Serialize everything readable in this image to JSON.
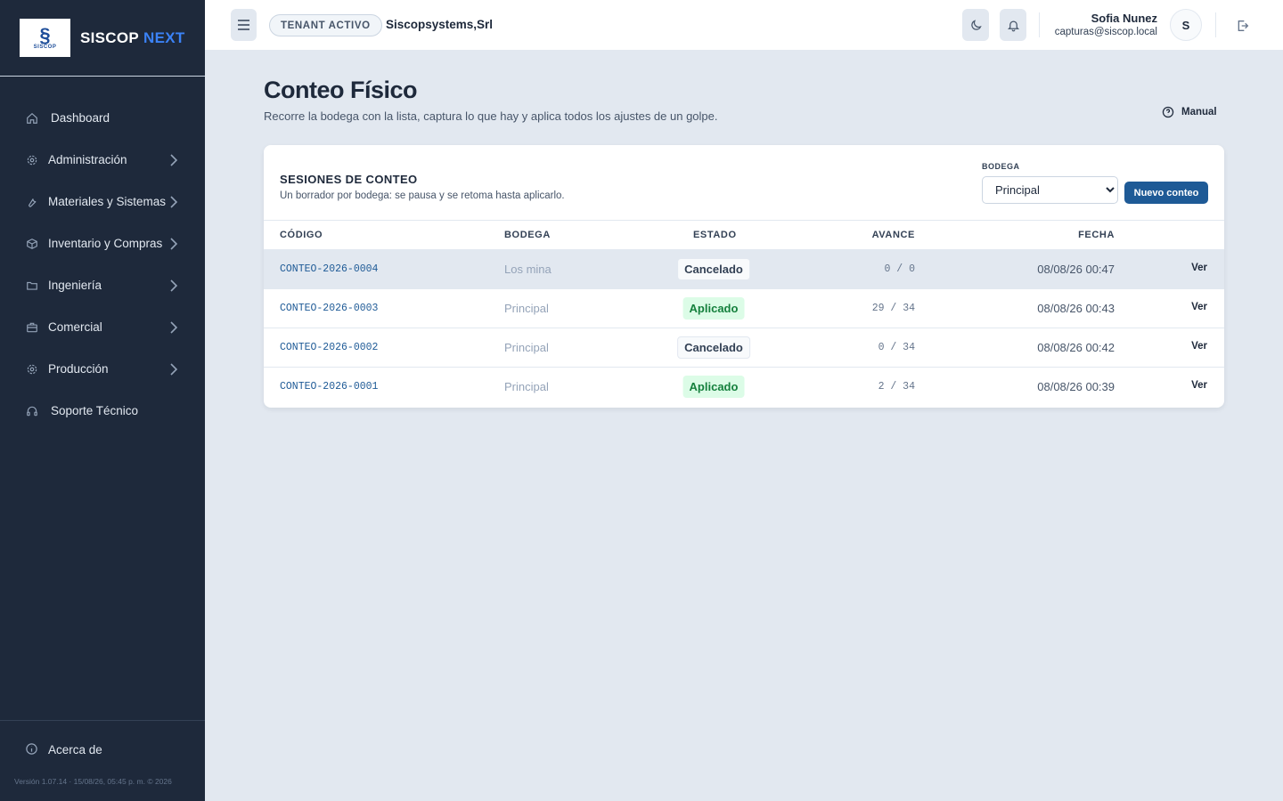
{
  "brand": {
    "logo_text": "SISCOP",
    "name": "SISCOP",
    "name_accent": "NEXT"
  },
  "sidebar": {
    "items": [
      {
        "label": "Dashboard",
        "icon": "home-icon",
        "expandable": false
      },
      {
        "label": "Administración",
        "icon": "gear-icon",
        "expandable": true
      },
      {
        "label": "Materiales y Sistemas",
        "icon": "wrench-icon",
        "expandable": true
      },
      {
        "label": "Inventario y Compras",
        "icon": "box-icon",
        "expandable": true
      },
      {
        "label": "Ingeniería",
        "icon": "folder-icon",
        "expandable": true
      },
      {
        "label": "Comercial",
        "icon": "briefcase-icon",
        "expandable": true
      },
      {
        "label": "Producción",
        "icon": "gear-icon",
        "expandable": true
      },
      {
        "label": "Soporte Técnico",
        "icon": "headset-icon",
        "expandable": false
      }
    ],
    "footer": {
      "about_label": "Acerca de",
      "version": "Versión 1.07.14 · 15/08/26, 05:45 p. m. © 2026"
    }
  },
  "topbar": {
    "tenant_badge": "TENANT ACTIVO",
    "tenant_name": "Siscopsystems,Srl",
    "user_name": "Sofia Nunez",
    "user_email": "capturas@siscop.local",
    "avatar_initial": "S"
  },
  "page": {
    "title": "Conteo Físico",
    "subtitle": "Recorre la bodega con la lista, captura lo que hay y aplica todos los ajustes de un golpe.",
    "manual_label": "Manual"
  },
  "sessions": {
    "title": "SESIONES DE CONTEO",
    "subtitle": "Un borrador por bodega: se pausa y se retoma hasta aplicarlo.",
    "filter_label": "BODEGA",
    "filter_value": "Principal",
    "new_button": "Nuevo conteo",
    "columns": {
      "code": "CÓDIGO",
      "bodega": "BODEGA",
      "estado": "ESTADO",
      "avance": "AVANCE",
      "fecha": "FECHA"
    },
    "rows": [
      {
        "code": "CONTEO-2026-0004",
        "bodega": "Los mina",
        "estado": "Cancelado",
        "avance": "0 / 0",
        "fecha": "08/08/26 00:47",
        "action": "Ver"
      },
      {
        "code": "CONTEO-2026-0003",
        "bodega": "Principal",
        "estado": "Aplicado",
        "avance": "29 / 34",
        "fecha": "08/08/26 00:43",
        "action": "Ver"
      },
      {
        "code": "CONTEO-2026-0002",
        "bodega": "Principal",
        "estado": "Cancelado",
        "avance": "0 / 34",
        "fecha": "08/08/26 00:42",
        "action": "Ver"
      },
      {
        "code": "CONTEO-2026-0001",
        "bodega": "Principal",
        "estado": "Aplicado",
        "avance": "2 / 34",
        "fecha": "08/08/26 00:39",
        "action": "Ver"
      }
    ]
  },
  "colors": {
    "sidebar_bg": "#1e293b",
    "accent": "#3b82f6",
    "primary_button": "#1e5a96",
    "status_applied": "#15803d",
    "status_applied_bg": "#dcfce7"
  }
}
